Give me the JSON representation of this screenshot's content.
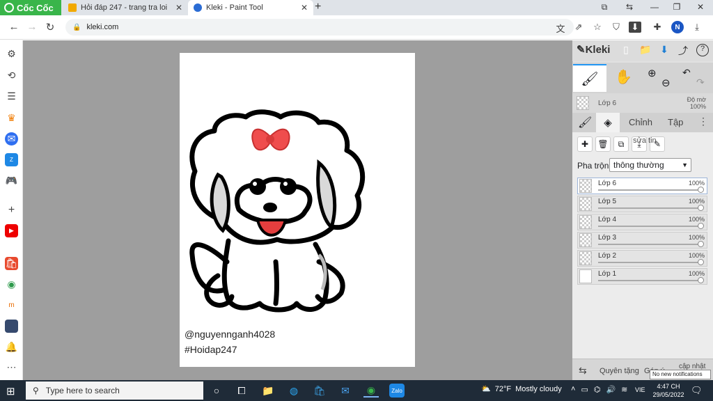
{
  "browser": {
    "brand": "Cốc Cốc",
    "tabs": [
      {
        "title": "Hỏi đáp 247 - trang tra loi",
        "favicon": "hoidap-favicon"
      },
      {
        "title": "Kleki - Paint Tool",
        "favicon": "kleki-favicon",
        "active": true
      }
    ],
    "address": "kleki.com",
    "avatar_letter": "N"
  },
  "canvas": {
    "signature_line1": "@nguyennganh4028",
    "signature_line2": "#Hoidap247"
  },
  "kleki": {
    "logo": "Kleki",
    "current_layer": "Lớp 6",
    "opacity_label": "Độ mờ",
    "opacity_value": "100%",
    "subtabs": {
      "edit": "Chỉnh",
      "file": "Tập"
    },
    "layer_tools_caption": "sửa tin",
    "blend_label": "Pha trộn",
    "blend_value": "thông thường",
    "layers": [
      {
        "name": "Lớp 6",
        "opacity": "100%",
        "selected": true
      },
      {
        "name": "Lớp 5",
        "opacity": "100%"
      },
      {
        "name": "Lớp 4",
        "opacity": "100%"
      },
      {
        "name": "Lớp 3",
        "opacity": "100%"
      },
      {
        "name": "Lớp 2",
        "opacity": "100%"
      },
      {
        "name": "Lớp 1",
        "opacity": "100%"
      }
    ],
    "bottom": {
      "donate": "Quyên tặng",
      "feedback": "Góp ý",
      "update": "cập nhật"
    },
    "no_notifications": "No new notifications"
  },
  "taskbar": {
    "search_placeholder": "Type here to search",
    "weather_temp": "72°F",
    "weather_text": "Mostly cloudy",
    "lang": "VIE",
    "time": "4:47 CH",
    "date": "29/05/2022"
  },
  "colors": {
    "accent": "#2196f3",
    "brand": "#39b54a",
    "bow": "#ef4d4d"
  }
}
